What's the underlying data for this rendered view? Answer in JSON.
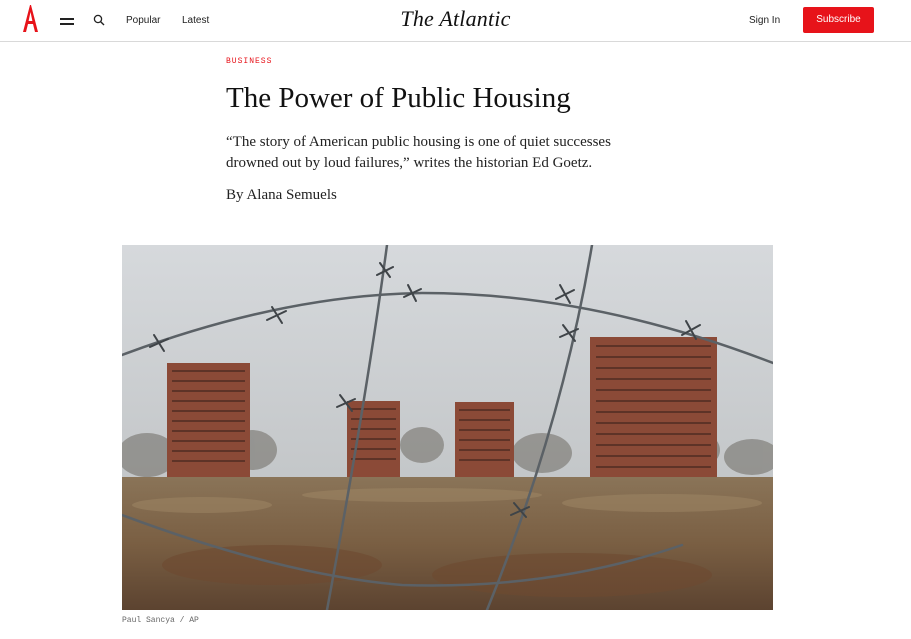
{
  "header": {
    "nav": {
      "popular": "Popular",
      "latest": "Latest"
    },
    "masthead": "The Atlantic",
    "sign_in": "Sign In",
    "subscribe": "Subscribe"
  },
  "article": {
    "section": "BUSINESS",
    "headline": "The Power of Public Housing",
    "dek": "“The story of American public housing is one of quiet successes drowned out by loud failures,” writes the historian Ed Goetz.",
    "byline_prefix": "By",
    "author": "Alana Semuels",
    "photo_credit": "Paul Sancya / AP"
  },
  "colors": {
    "brand_red": "#e7131a",
    "text": "#111111"
  },
  "icons": {
    "logo": "atlantic-a-logo",
    "menu": "hamburger-menu-icon",
    "search": "search-icon"
  }
}
